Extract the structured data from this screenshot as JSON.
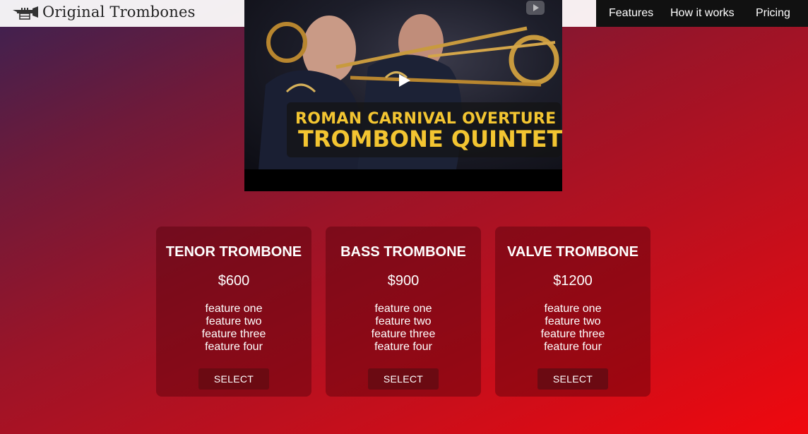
{
  "header": {
    "brand_name": "Original Trombones",
    "logo_icon": "trumpet-icon",
    "nav": [
      {
        "label": "Features"
      },
      {
        "label": "How it works"
      },
      {
        "label": "Pricing"
      }
    ]
  },
  "video": {
    "caption_line1": "ROMAN CARNIVAL OVERTURE",
    "caption_line2": "TROMBONE QUINTET",
    "play_icon": "play-icon",
    "youtube_icon": "youtube-icon"
  },
  "pricing": {
    "plans": [
      {
        "title": "TENOR TROMBONE",
        "price": "$600",
        "features": [
          "feature one",
          "feature two",
          "feature three",
          "feature four"
        ],
        "button": "SELECT"
      },
      {
        "title": "BASS TROMBONE",
        "price": "$900",
        "features": [
          "feature one",
          "feature two",
          "feature three",
          "feature four"
        ],
        "button": "SELECT"
      },
      {
        "title": "VALVE TROMBONE",
        "price": "$1200",
        "features": [
          "feature one",
          "feature two",
          "feature three",
          "feature four"
        ],
        "button": "SELECT"
      }
    ]
  },
  "colors": {
    "nav_background": "#111111",
    "caption_text": "#f3c531",
    "button_background": "#6b0a12",
    "gradient_start": "#3b2252",
    "gradient_end": "#f0080e"
  }
}
